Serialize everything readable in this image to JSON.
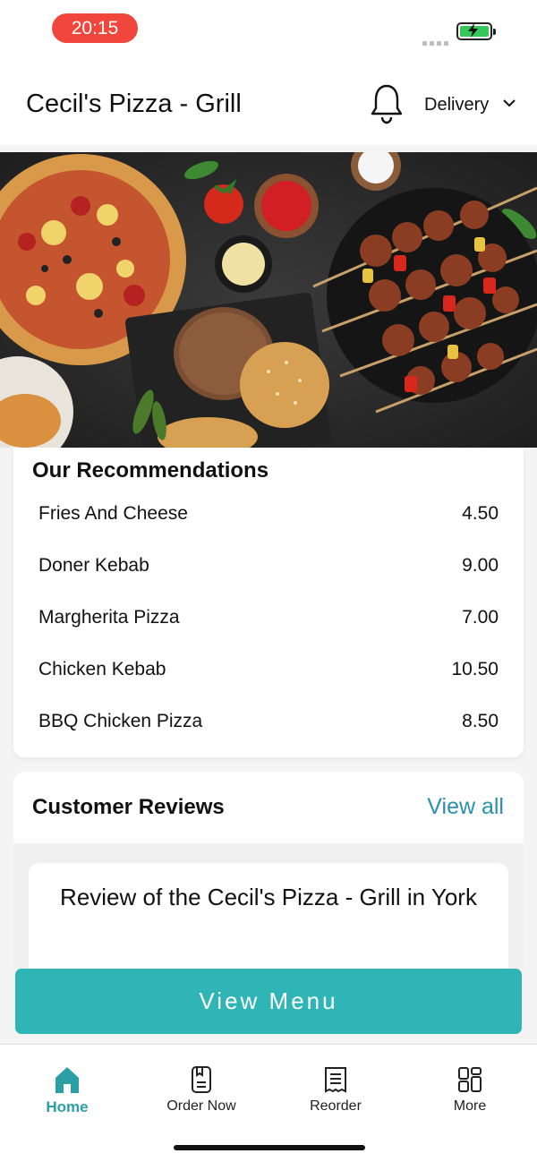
{
  "status": {
    "time": "20:15"
  },
  "header": {
    "title": "Cecil's Pizza - Grill",
    "mode_label": "Delivery"
  },
  "recommendations": {
    "title": "Our Recommendations",
    "items": [
      {
        "name": "Fries And Cheese",
        "price": "4.50"
      },
      {
        "name": "Doner Kebab",
        "price": "9.00"
      },
      {
        "name": "Margherita Pizza",
        "price": "7.00"
      },
      {
        "name": "Chicken Kebab",
        "price": "10.50"
      },
      {
        "name": "BBQ Chicken Pizza",
        "price": "8.50"
      }
    ]
  },
  "reviews": {
    "title": "Customer Reviews",
    "view_all": "View all",
    "heading": "Review of the Cecil's Pizza - Grill in York"
  },
  "cta": {
    "label": "View Menu"
  },
  "tabs": [
    {
      "label": "Home",
      "icon": "home-icon"
    },
    {
      "label": "Order Now",
      "icon": "order-icon"
    },
    {
      "label": "Reorder",
      "icon": "receipt-icon"
    },
    {
      "label": "More",
      "icon": "grid-icon"
    }
  ],
  "colors": {
    "accent": "#2fb5b5",
    "link": "#2a8fb0",
    "time_pill": "#f0463c",
    "battery": "#35c759"
  }
}
